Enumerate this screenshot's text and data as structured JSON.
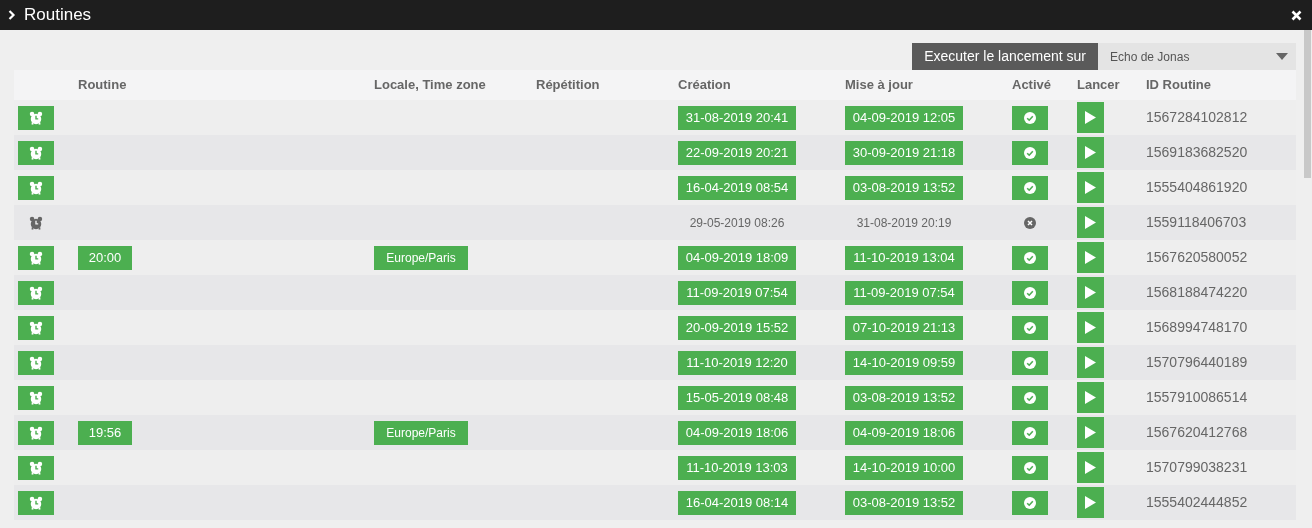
{
  "window": {
    "title": "Routines"
  },
  "toolbar": {
    "launch_label": "Executer le lancement sur",
    "device_select": {
      "value": "Echo de Jonas"
    }
  },
  "table": {
    "columns": [
      "Routine",
      "Locale, Time zone",
      "Répétition",
      "Création",
      "Mise à jour",
      "Activé",
      "Lancer",
      "ID Routine"
    ],
    "rows": [
      {
        "enabled": true,
        "created": "31-08-2019 20:41",
        "updated": "04-09-2019 12:05",
        "id": "1567284102812"
      },
      {
        "enabled": true,
        "created": "22-09-2019 20:21",
        "updated": "30-09-2019 21:18",
        "id": "1569183682520"
      },
      {
        "enabled": true,
        "created": "16-04-2019 08:54",
        "updated": "03-08-2019 13:52",
        "id": "1555404861920"
      },
      {
        "enabled": false,
        "created": "29-05-2019 08:26",
        "updated": "31-08-2019 20:19",
        "id": "1559118406703"
      },
      {
        "enabled": true,
        "time": "20:00",
        "locale": "Europe/Paris",
        "created": "04-09-2019 18:09",
        "updated": "11-10-2019 13:04",
        "id": "1567620580052"
      },
      {
        "enabled": true,
        "created": "11-09-2019 07:54",
        "updated": "11-09-2019 07:54",
        "id": "1568188474220"
      },
      {
        "enabled": true,
        "created": "20-09-2019 15:52",
        "updated": "07-10-2019 21:13",
        "id": "1568994748170"
      },
      {
        "enabled": true,
        "created": "11-10-2019 12:20",
        "updated": "14-10-2019 09:59",
        "id": "1570796440189"
      },
      {
        "enabled": true,
        "created": "15-05-2019 08:48",
        "updated": "03-08-2019 13:52",
        "id": "1557910086514"
      },
      {
        "enabled": true,
        "time": "19:56",
        "locale": "Europe/Paris",
        "created": "04-09-2019 18:06",
        "updated": "04-09-2019 18:06",
        "id": "1567620412768"
      },
      {
        "enabled": true,
        "created": "11-10-2019 13:03",
        "updated": "14-10-2019 10:00",
        "id": "1570799038231"
      },
      {
        "enabled": true,
        "created": "16-04-2019 08:14",
        "updated": "03-08-2019 13:52",
        "id": "1555402444852"
      }
    ]
  }
}
